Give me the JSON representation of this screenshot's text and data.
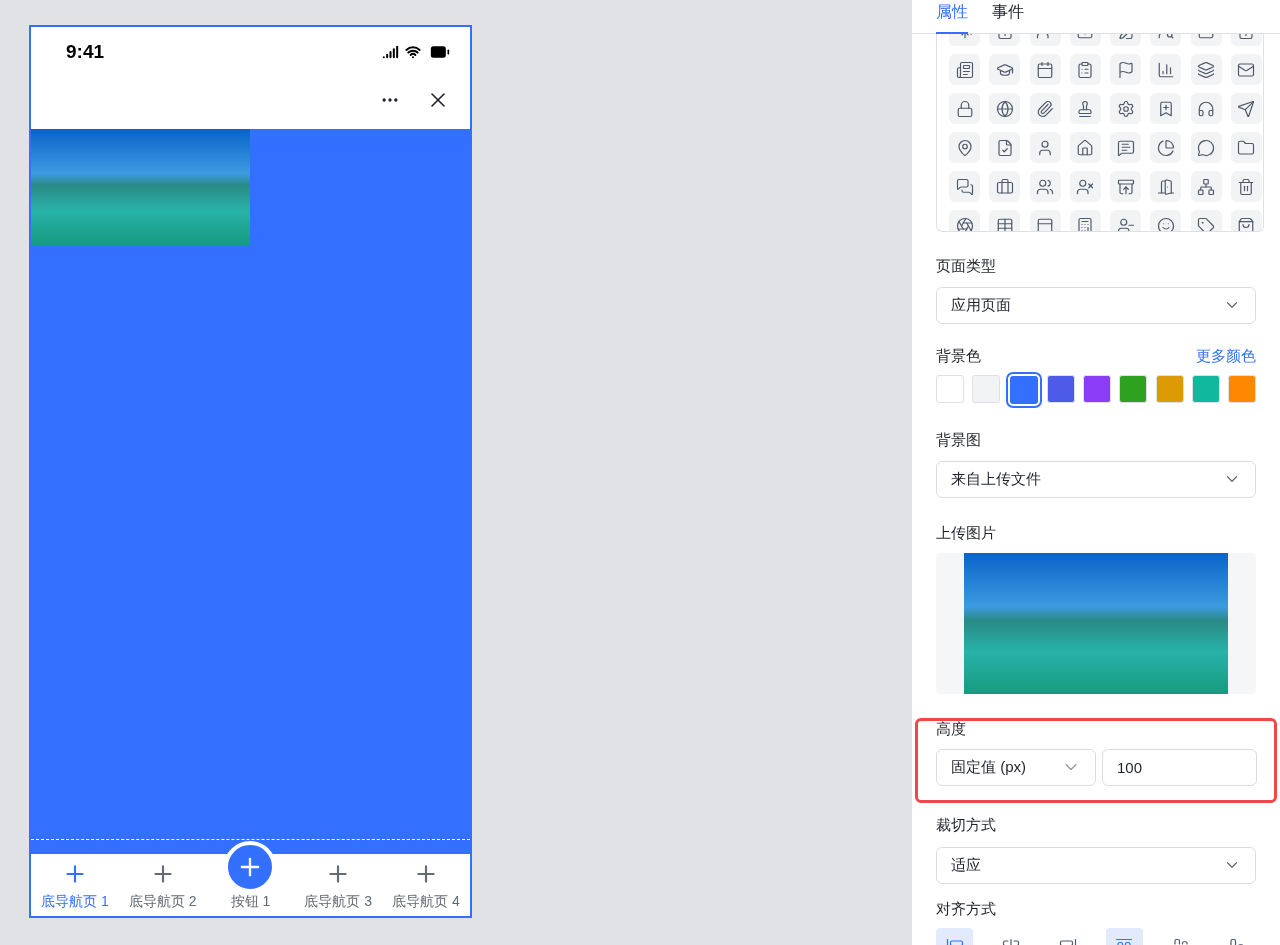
{
  "phone": {
    "status_bar": {
      "time": "9:41"
    },
    "tab_bar": [
      {
        "kind": "tab",
        "label": "底导航页 1",
        "selected": true
      },
      {
        "kind": "tab",
        "label": "底导航页 2",
        "selected": false
      },
      {
        "kind": "button",
        "label": "按钮 1",
        "selected": false
      },
      {
        "kind": "tab",
        "label": "底导航页 3",
        "selected": false
      },
      {
        "kind": "tab",
        "label": "底导航页 4",
        "selected": false
      }
    ]
  },
  "panel": {
    "tabs": [
      {
        "label": "属性",
        "selected": true
      },
      {
        "label": "事件",
        "selected": false
      }
    ],
    "page_type": {
      "label": "页面类型",
      "value": "应用页面"
    },
    "background_color": {
      "label": "背景色",
      "link": "更多颜色",
      "swatches": [
        {
          "color": "#ffffff",
          "selected": false
        },
        {
          "color": "#f2f3f5",
          "selected": false
        },
        {
          "color": "#3370ff",
          "selected": true
        },
        {
          "color": "#4e5ae8",
          "selected": false
        },
        {
          "color": "#8b3cf7",
          "selected": false
        },
        {
          "color": "#2ea121",
          "selected": false
        },
        {
          "color": "#dc9b04",
          "selected": false
        },
        {
          "color": "#10b89e",
          "selected": false
        },
        {
          "color": "#ff8800",
          "selected": false
        }
      ]
    },
    "background_image": {
      "label": "背景图",
      "value": "来自上传文件"
    },
    "upload": {
      "label": "上传图片"
    },
    "height": {
      "label": "高度",
      "mode": "固定值 (px)",
      "value": "100"
    },
    "crop": {
      "label": "裁切方式",
      "value": "适应"
    },
    "align": {
      "label": "对齐方式",
      "options": [
        {
          "selected": true
        },
        {
          "selected": false
        },
        {
          "selected": false
        },
        {
          "selected": true
        },
        {
          "selected": false
        },
        {
          "selected": false
        }
      ]
    }
  }
}
